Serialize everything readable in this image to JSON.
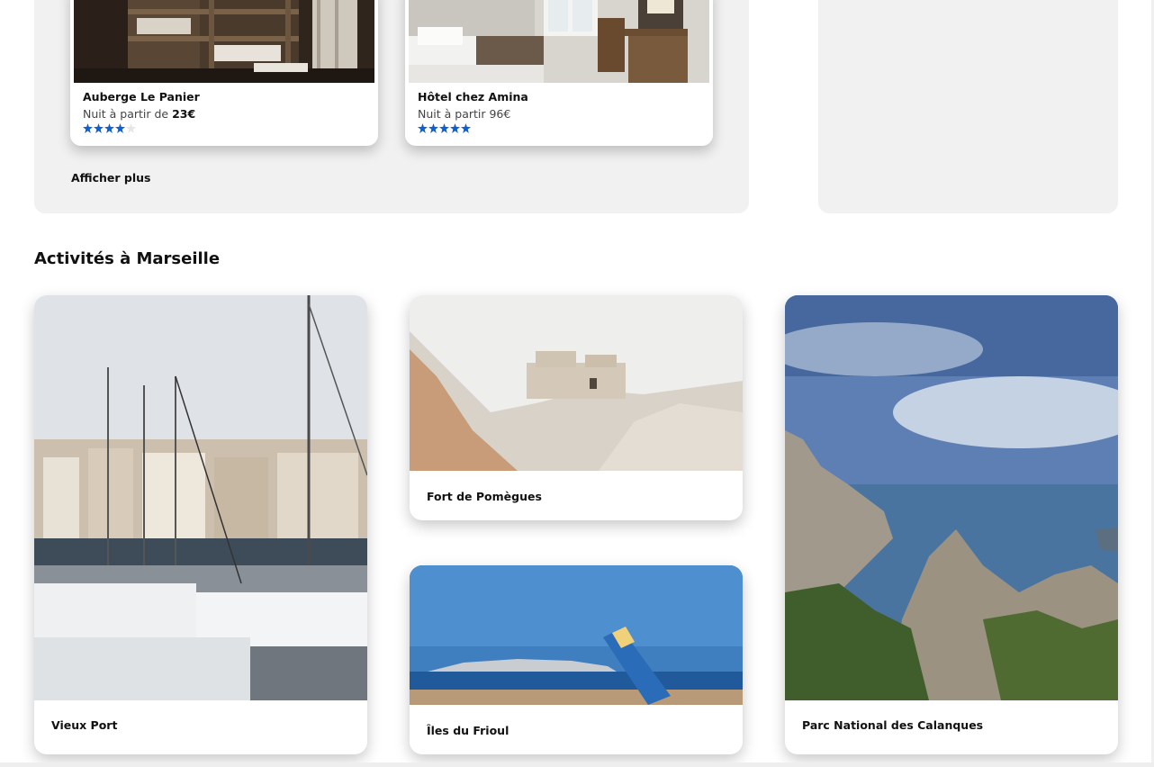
{
  "hotels": [
    {
      "name": "Auberge Le Panier",
      "price_prefix": "Nuit à partir de ",
      "price": "23€",
      "rating": 4,
      "max_rating": 5
    },
    {
      "name": "Hôtel chez Amina",
      "price_prefix": "Nuit à partir ",
      "price": "96€",
      "rating": 5,
      "max_rating": 5
    }
  ],
  "show_more_label": "Afficher plus",
  "activities_title": "Activités à Marseille",
  "activities": [
    {
      "label": "Vieux Port"
    },
    {
      "label": "Fort de Pomègues"
    },
    {
      "label": "Îles du Frioul"
    },
    {
      "label": "Parc National des Calanques"
    }
  ],
  "colors": {
    "star_active": "#0b5fd6",
    "star_inactive": "#e6e6e6",
    "panel_bg": "#f1f1f1"
  }
}
